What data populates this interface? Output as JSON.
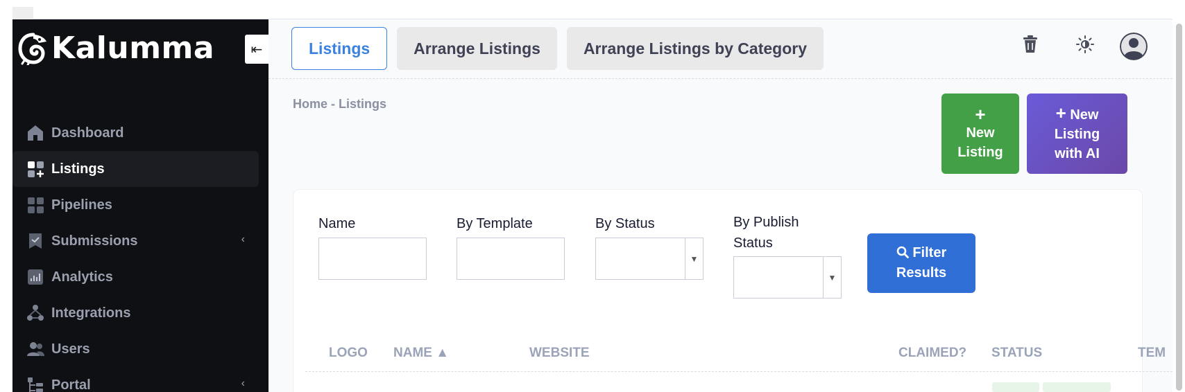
{
  "brand": {
    "name": "Kalumma"
  },
  "sidebar": {
    "items": [
      {
        "label": "Dashboard",
        "icon": "home-icon"
      },
      {
        "label": "Listings",
        "icon": "listings-icon",
        "active": true
      },
      {
        "label": "Pipelines",
        "icon": "pipelines-icon"
      },
      {
        "label": "Submissions",
        "icon": "submissions-icon",
        "expandable": true
      },
      {
        "label": "Analytics",
        "icon": "analytics-icon"
      },
      {
        "label": "Integrations",
        "icon": "integrations-icon"
      },
      {
        "label": "Users",
        "icon": "users-icon"
      },
      {
        "label": "Portal",
        "icon": "portal-icon",
        "expandable": true
      }
    ]
  },
  "header": {
    "tabs": [
      {
        "label": "Listings",
        "active": true
      },
      {
        "label": "Arrange Listings"
      },
      {
        "label": "Arrange Listings by Category"
      }
    ],
    "icons": [
      "trash-icon",
      "theme-toggle-icon",
      "user-avatar-icon"
    ]
  },
  "breadcrumb": "Home - Listings",
  "actions": {
    "new_listing": {
      "plus": "+",
      "line1": "New",
      "line2": "Listing"
    },
    "new_listing_ai": {
      "line1": "New",
      "line2": "Listing",
      "line3": "with AI"
    }
  },
  "filters": {
    "name_label": "Name",
    "template_label": "By Template",
    "status_label": "By Status",
    "publish_label_1": "By Publish",
    "publish_label_2": "Status",
    "name_value": "",
    "template_value": "",
    "filter_button_line1": "Filter",
    "filter_button_line2": "Results"
  },
  "table": {
    "columns": [
      "LOGO",
      "NAME",
      "WEBSITE",
      "CLAIMED?",
      "STATUS",
      "TEM"
    ],
    "sort_indicator": "▲"
  },
  "colors": {
    "sidebar_bg": "#0f1014",
    "primary": "#3b82e0",
    "success": "#43a047",
    "ai_gradient_start": "#6a5bd8",
    "ai_gradient_end": "#6b48a8",
    "filter_button": "#2f6fd6"
  }
}
